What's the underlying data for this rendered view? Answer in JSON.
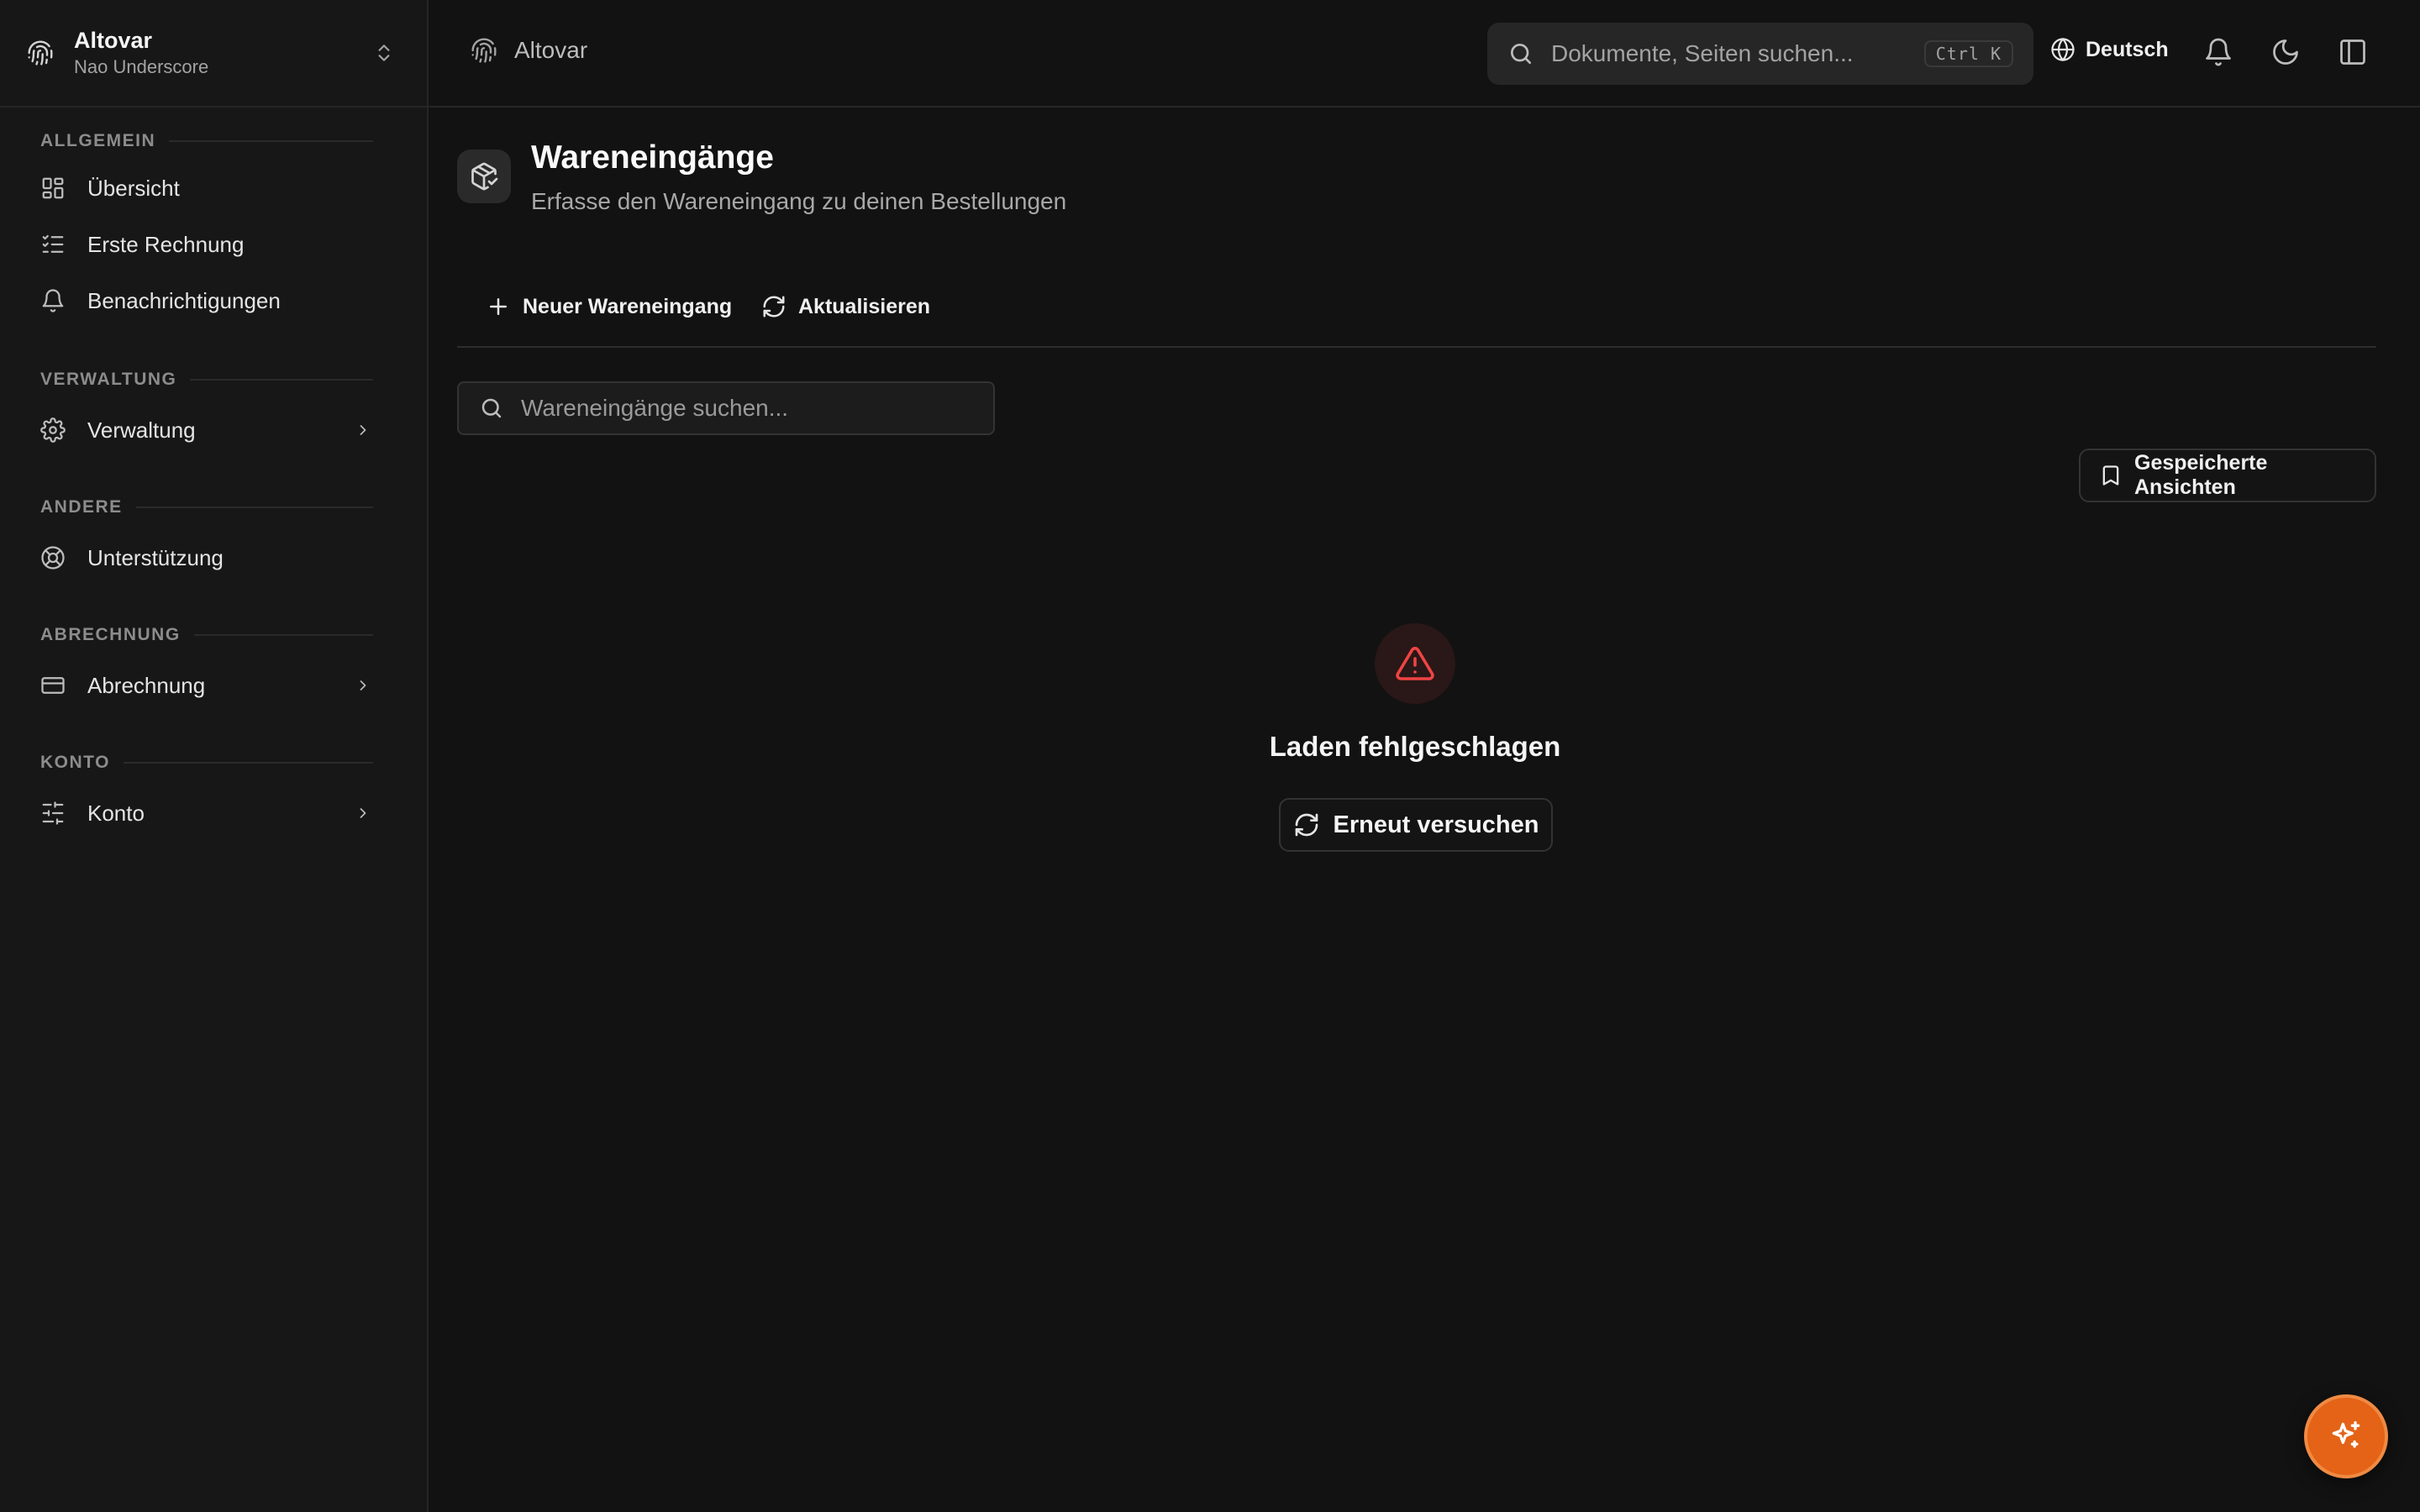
{
  "org": {
    "name": "Altovar",
    "user": "Nao Underscore"
  },
  "sidebar": {
    "sections": [
      {
        "title": "ALLGEMEIN",
        "items": [
          {
            "label": "Übersicht",
            "icon": "dashboard-icon"
          },
          {
            "label": "Erste Rechnung",
            "icon": "checklist-icon"
          },
          {
            "label": "Benachrichtigungen",
            "icon": "bell-icon"
          }
        ]
      },
      {
        "title": "VERWALTUNG",
        "items": [
          {
            "label": "Verwaltung",
            "icon": "gear-icon",
            "has_submenu": true
          }
        ]
      },
      {
        "title": "ANDERE",
        "items": [
          {
            "label": "Unterstützung",
            "icon": "lifebuoy-icon"
          }
        ]
      },
      {
        "title": "ABRECHNUNG",
        "items": [
          {
            "label": "Abrechnung",
            "icon": "credit-card-icon",
            "has_submenu": true
          }
        ]
      },
      {
        "title": "KONTO",
        "items": [
          {
            "label": "Konto",
            "icon": "sliders-icon",
            "has_submenu": true
          }
        ]
      }
    ]
  },
  "topbar": {
    "breadcrumb": "Altovar",
    "search_placeholder": "Dokumente, Seiten suchen...",
    "shortcut": "Ctrl K",
    "language": "Deutsch"
  },
  "page": {
    "title": "Wareneingänge",
    "subtitle": "Erfasse den Wareneingang zu deinen Bestellungen",
    "actions": {
      "new": "Neuer Wareneingang",
      "refresh": "Aktualisieren"
    },
    "search_placeholder": "Wareneingänge suchen...",
    "saved_views": "Gespeicherte Ansichten",
    "error": {
      "message": "Laden fehlgeschlagen",
      "retry": "Erneut versuchen"
    }
  },
  "colors": {
    "accent": "#e46317",
    "error": "#ef4444",
    "background": "#121212",
    "sidebar": "#171717"
  }
}
